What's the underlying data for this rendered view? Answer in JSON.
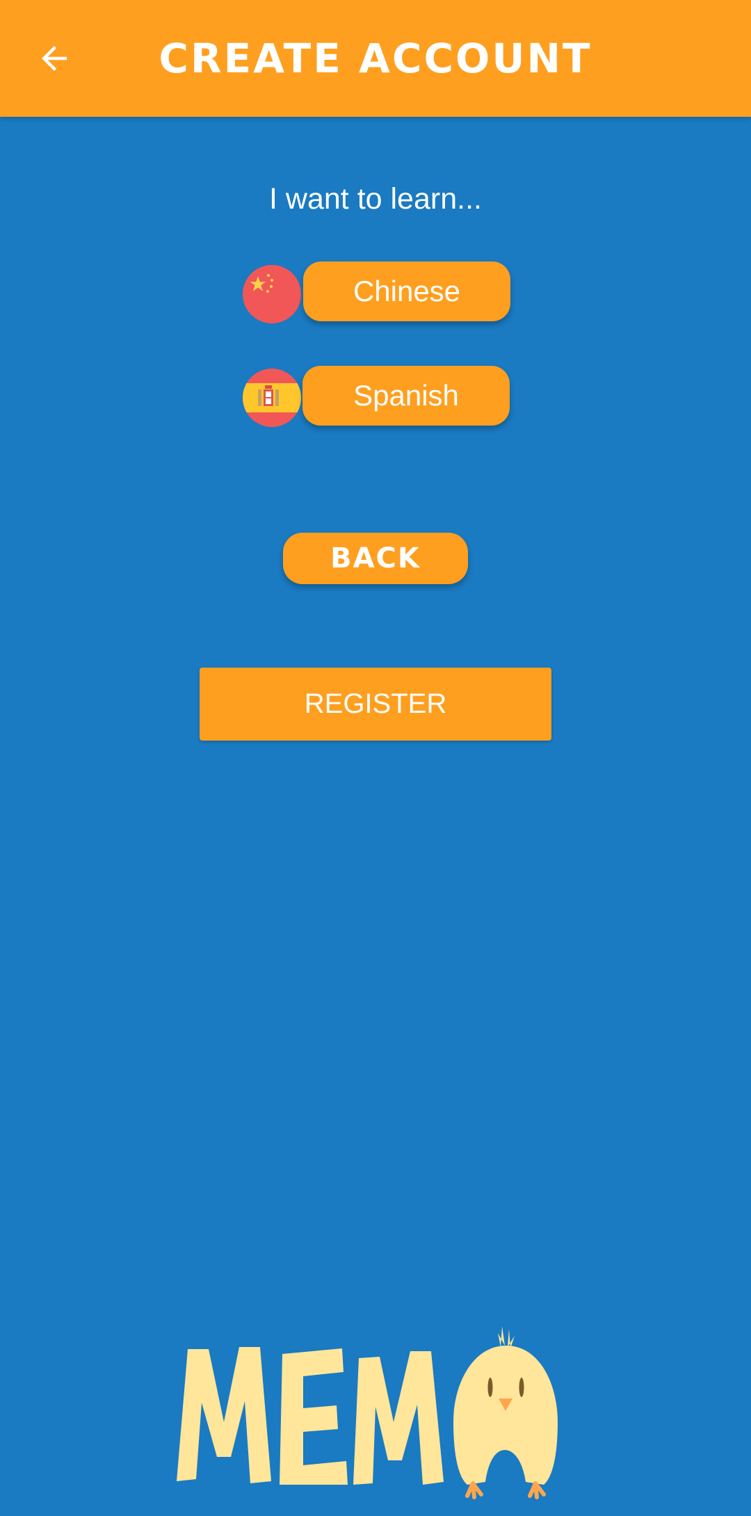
{
  "header": {
    "title": "CREATE ACCOUNT",
    "back_icon": "arrow-left-icon"
  },
  "prompt": "I want to learn...",
  "languages": [
    {
      "label": "Chinese",
      "flag_icon": "china-flag-icon"
    },
    {
      "label": "Spanish",
      "flag_icon": "spain-flag-icon"
    }
  ],
  "buttons": {
    "back_label": "BACK",
    "register_label": "REGISTER"
  },
  "logo": {
    "text": "MEMO",
    "mascot_icon": "chick-mascot-icon"
  },
  "colors": {
    "background": "#1a7ac2",
    "accent": "#ff9f1f",
    "text": "#ffffff",
    "logo": "#ffe69a"
  }
}
